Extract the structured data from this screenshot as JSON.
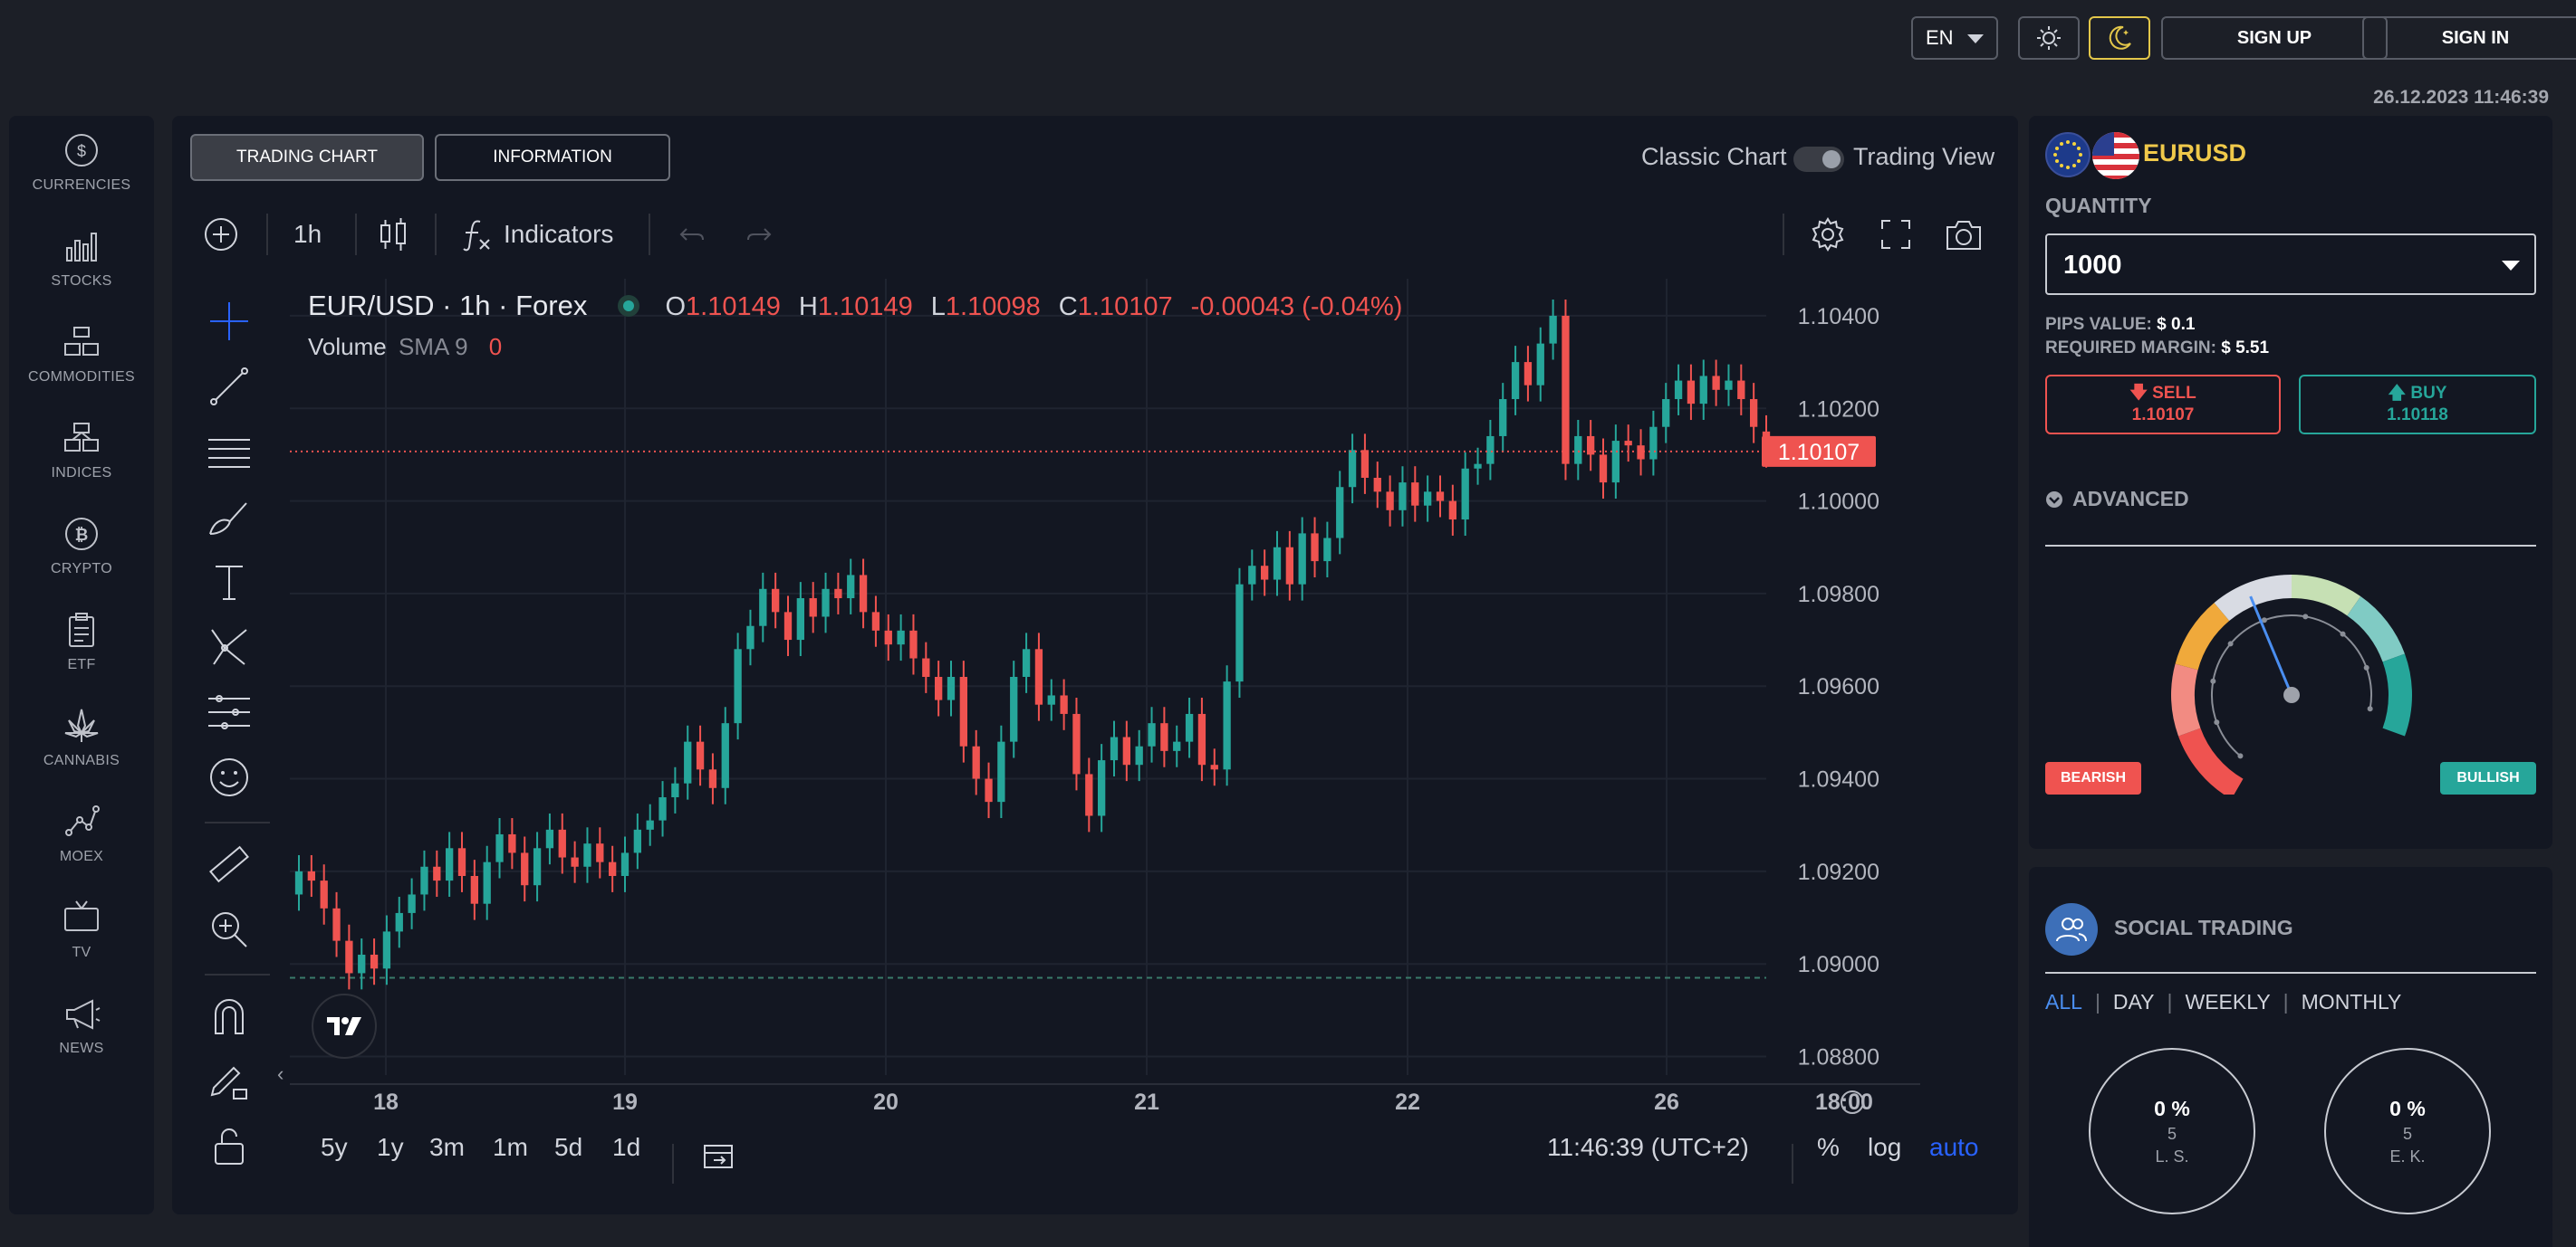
{
  "header": {
    "language": "EN",
    "sign_up": "SIGN UP",
    "sign_in": "SIGN IN",
    "datetime": "26.12.2023 11:46:39",
    "theme_accent": "#e3c74a"
  },
  "sidebar": {
    "items": [
      {
        "label": "CURRENCIES",
        "icon": "currency-coin-icon"
      },
      {
        "label": "STOCKS",
        "icon": "bar-chart-icon"
      },
      {
        "label": "COMMODITIES",
        "icon": "commodities-icon"
      },
      {
        "label": "INDICES",
        "icon": "indices-icon"
      },
      {
        "label": "CRYPTO",
        "icon": "crypto-icon"
      },
      {
        "label": "ETF",
        "icon": "clipboard-icon"
      },
      {
        "label": "CANNABIS",
        "icon": "cannabis-leaf-icon"
      },
      {
        "label": "MOEX",
        "icon": "nodes-icon"
      },
      {
        "label": "TV",
        "icon": "tv-icon"
      },
      {
        "label": "NEWS",
        "icon": "megaphone-icon"
      }
    ]
  },
  "main": {
    "tabs": [
      {
        "label": "TRADING CHART",
        "active": true
      },
      {
        "label": "INFORMATION",
        "active": false
      }
    ],
    "view_toggle": {
      "left": "Classic Chart",
      "right": "Trading View"
    },
    "toolbar": {
      "interval": "1h",
      "indicators": "Indicators"
    },
    "legend": {
      "symbol": "EUR/USD · 1h · Forex",
      "open_label": "O",
      "open": "1.10149",
      "high_label": "H",
      "high": "1.10149",
      "low_label": "L",
      "low": "1.10098",
      "close_label": "C",
      "close": "1.10107",
      "change": "-0.00043 (-0.04%)",
      "volume_label": "Volume",
      "sma_label": "SMA 9",
      "volume_value": "0"
    },
    "bottom": {
      "ranges": [
        "5y",
        "1y",
        "3m",
        "1m",
        "5d",
        "1d"
      ],
      "clock": "11:46:39 (UTC+2)",
      "percent": "%",
      "log": "log",
      "auto": "auto"
    },
    "colors": {
      "up": "#26a69a",
      "down": "#ef5350",
      "bg": "#131722",
      "grid": "#1f2430"
    }
  },
  "chart_data": {
    "type": "candlestick",
    "symbol": "EUR/USD",
    "interval": "1h",
    "x_ticks": [
      "18",
      "19",
      "20",
      "21",
      "22",
      "26",
      "18:00"
    ],
    "y_ticks": [
      "1.10400",
      "1.10200",
      "1.10000",
      "1.09800",
      "1.09600",
      "1.09400",
      "1.09200",
      "1.09000",
      "1.08800"
    ],
    "ylim": [
      1.0876,
      1.1048
    ],
    "last_price": "1.10107",
    "last_price_value": 1.10107,
    "dashed_level": 1.0897,
    "closes": [
      1.092,
      1.0918,
      1.0912,
      1.0905,
      1.0898,
      1.0902,
      1.0899,
      1.0907,
      1.0911,
      1.0915,
      1.0921,
      1.0918,
      1.0925,
      1.0919,
      1.0913,
      1.0922,
      1.0928,
      1.0924,
      1.0917,
      1.0925,
      1.0929,
      1.0923,
      1.0921,
      1.0926,
      1.0922,
      1.0919,
      1.0924,
      1.0929,
      1.0931,
      1.0936,
      1.0939,
      1.0948,
      1.0942,
      1.0938,
      1.0952,
      1.0968,
      1.0973,
      1.0981,
      1.0976,
      1.097,
      1.0979,
      1.0975,
      1.0981,
      1.0979,
      1.0984,
      1.0976,
      1.0972,
      1.0969,
      1.0972,
      1.0966,
      1.0962,
      1.0957,
      1.0962,
      1.0947,
      1.094,
      1.0935,
      1.0948,
      1.0962,
      1.0968,
      1.0956,
      1.0958,
      1.0954,
      1.0941,
      1.0932,
      1.0944,
      1.0949,
      1.0943,
      1.0947,
      1.0952,
      1.0946,
      1.0948,
      1.0954,
      1.0943,
      1.0942,
      1.0961,
      1.0982,
      1.0986,
      1.0983,
      1.099,
      1.0982,
      1.0993,
      1.0987,
      1.0992,
      1.1003,
      1.1011,
      1.1005,
      1.1002,
      1.0998,
      1.1004,
      1.0999,
      1.1002,
      1.1,
      1.0996,
      1.1007,
      1.1008,
      1.1014,
      1.1022,
      1.103,
      1.1025,
      1.1034,
      1.104,
      1.1008,
      1.1014,
      1.101,
      1.1004,
      1.1013,
      1.1012,
      1.1009,
      1.1016,
      1.1022,
      1.1026,
      1.1021,
      1.1027,
      1.1024,
      1.1026,
      1.1022,
      1.1016,
      1.10107
    ],
    "opens": [
      1.0915,
      1.092,
      1.0918,
      1.0912,
      1.0905,
      1.0898,
      1.0902,
      1.0899,
      1.0907,
      1.0911,
      1.0915,
      1.0921,
      1.0918,
      1.0925,
      1.0919,
      1.0913,
      1.0922,
      1.0928,
      1.0924,
      1.0917,
      1.0925,
      1.0929,
      1.0923,
      1.0921,
      1.0926,
      1.0922,
      1.0919,
      1.0924,
      1.0929,
      1.0931,
      1.0936,
      1.0939,
      1.0948,
      1.0942,
      1.0938,
      1.0952,
      1.0968,
      1.0973,
      1.0981,
      1.0976,
      1.097,
      1.0979,
      1.0975,
      1.0981,
      1.0979,
      1.0984,
      1.0976,
      1.0972,
      1.0969,
      1.0972,
      1.0966,
      1.0962,
      1.0957,
      1.0962,
      1.0947,
      1.094,
      1.0935,
      1.0948,
      1.0962,
      1.0968,
      1.0956,
      1.0958,
      1.0954,
      1.0941,
      1.0932,
      1.0944,
      1.0949,
      1.0943,
      1.0947,
      1.0952,
      1.0946,
      1.0948,
      1.0954,
      1.0943,
      1.0942,
      1.0961,
      1.0982,
      1.0986,
      1.0983,
      1.099,
      1.0982,
      1.0993,
      1.0987,
      1.0992,
      1.1003,
      1.1011,
      1.1005,
      1.1002,
      1.0998,
      1.1004,
      1.0999,
      1.1002,
      1.1,
      1.0996,
      1.1007,
      1.1008,
      1.1014,
      1.1022,
      1.103,
      1.1025,
      1.1034,
      1.104,
      1.1008,
      1.1014,
      1.101,
      1.1004,
      1.1013,
      1.1012,
      1.1009,
      1.1016,
      1.1022,
      1.1026,
      1.1021,
      1.1027,
      1.1024,
      1.1026,
      1.1022,
      1.1015
    ]
  },
  "trade": {
    "symbol": "EURUSD",
    "quantity_label": "QUANTITY",
    "quantity_value": "1000",
    "pips_label": "PIPS VALUE:",
    "pips_value": "$ 0.1",
    "margin_label": "REQUIRED MARGIN:",
    "margin_value": "$ 5.51",
    "sell_label": "SELL",
    "sell_price": "1.10107",
    "buy_label": "BUY",
    "buy_price": "1.10118",
    "advanced_label": "ADVANCED",
    "bearish": "BEARISH",
    "bullish": "BULLISH",
    "sentiment_value": 0.49,
    "symbol_color": "#f0c94a",
    "sell_color": "#ef5350",
    "buy_color": "#26a69a"
  },
  "social": {
    "title": "SOCIAL TRADING",
    "filters": [
      "ALL",
      "DAY",
      "WEEKLY",
      "MONTHLY"
    ],
    "active_filter": "ALL",
    "traders": [
      {
        "percent": "0 %",
        "count": "5",
        "initials": "L. S."
      },
      {
        "percent": "0 %",
        "count": "5",
        "initials": "E. K."
      }
    ]
  }
}
